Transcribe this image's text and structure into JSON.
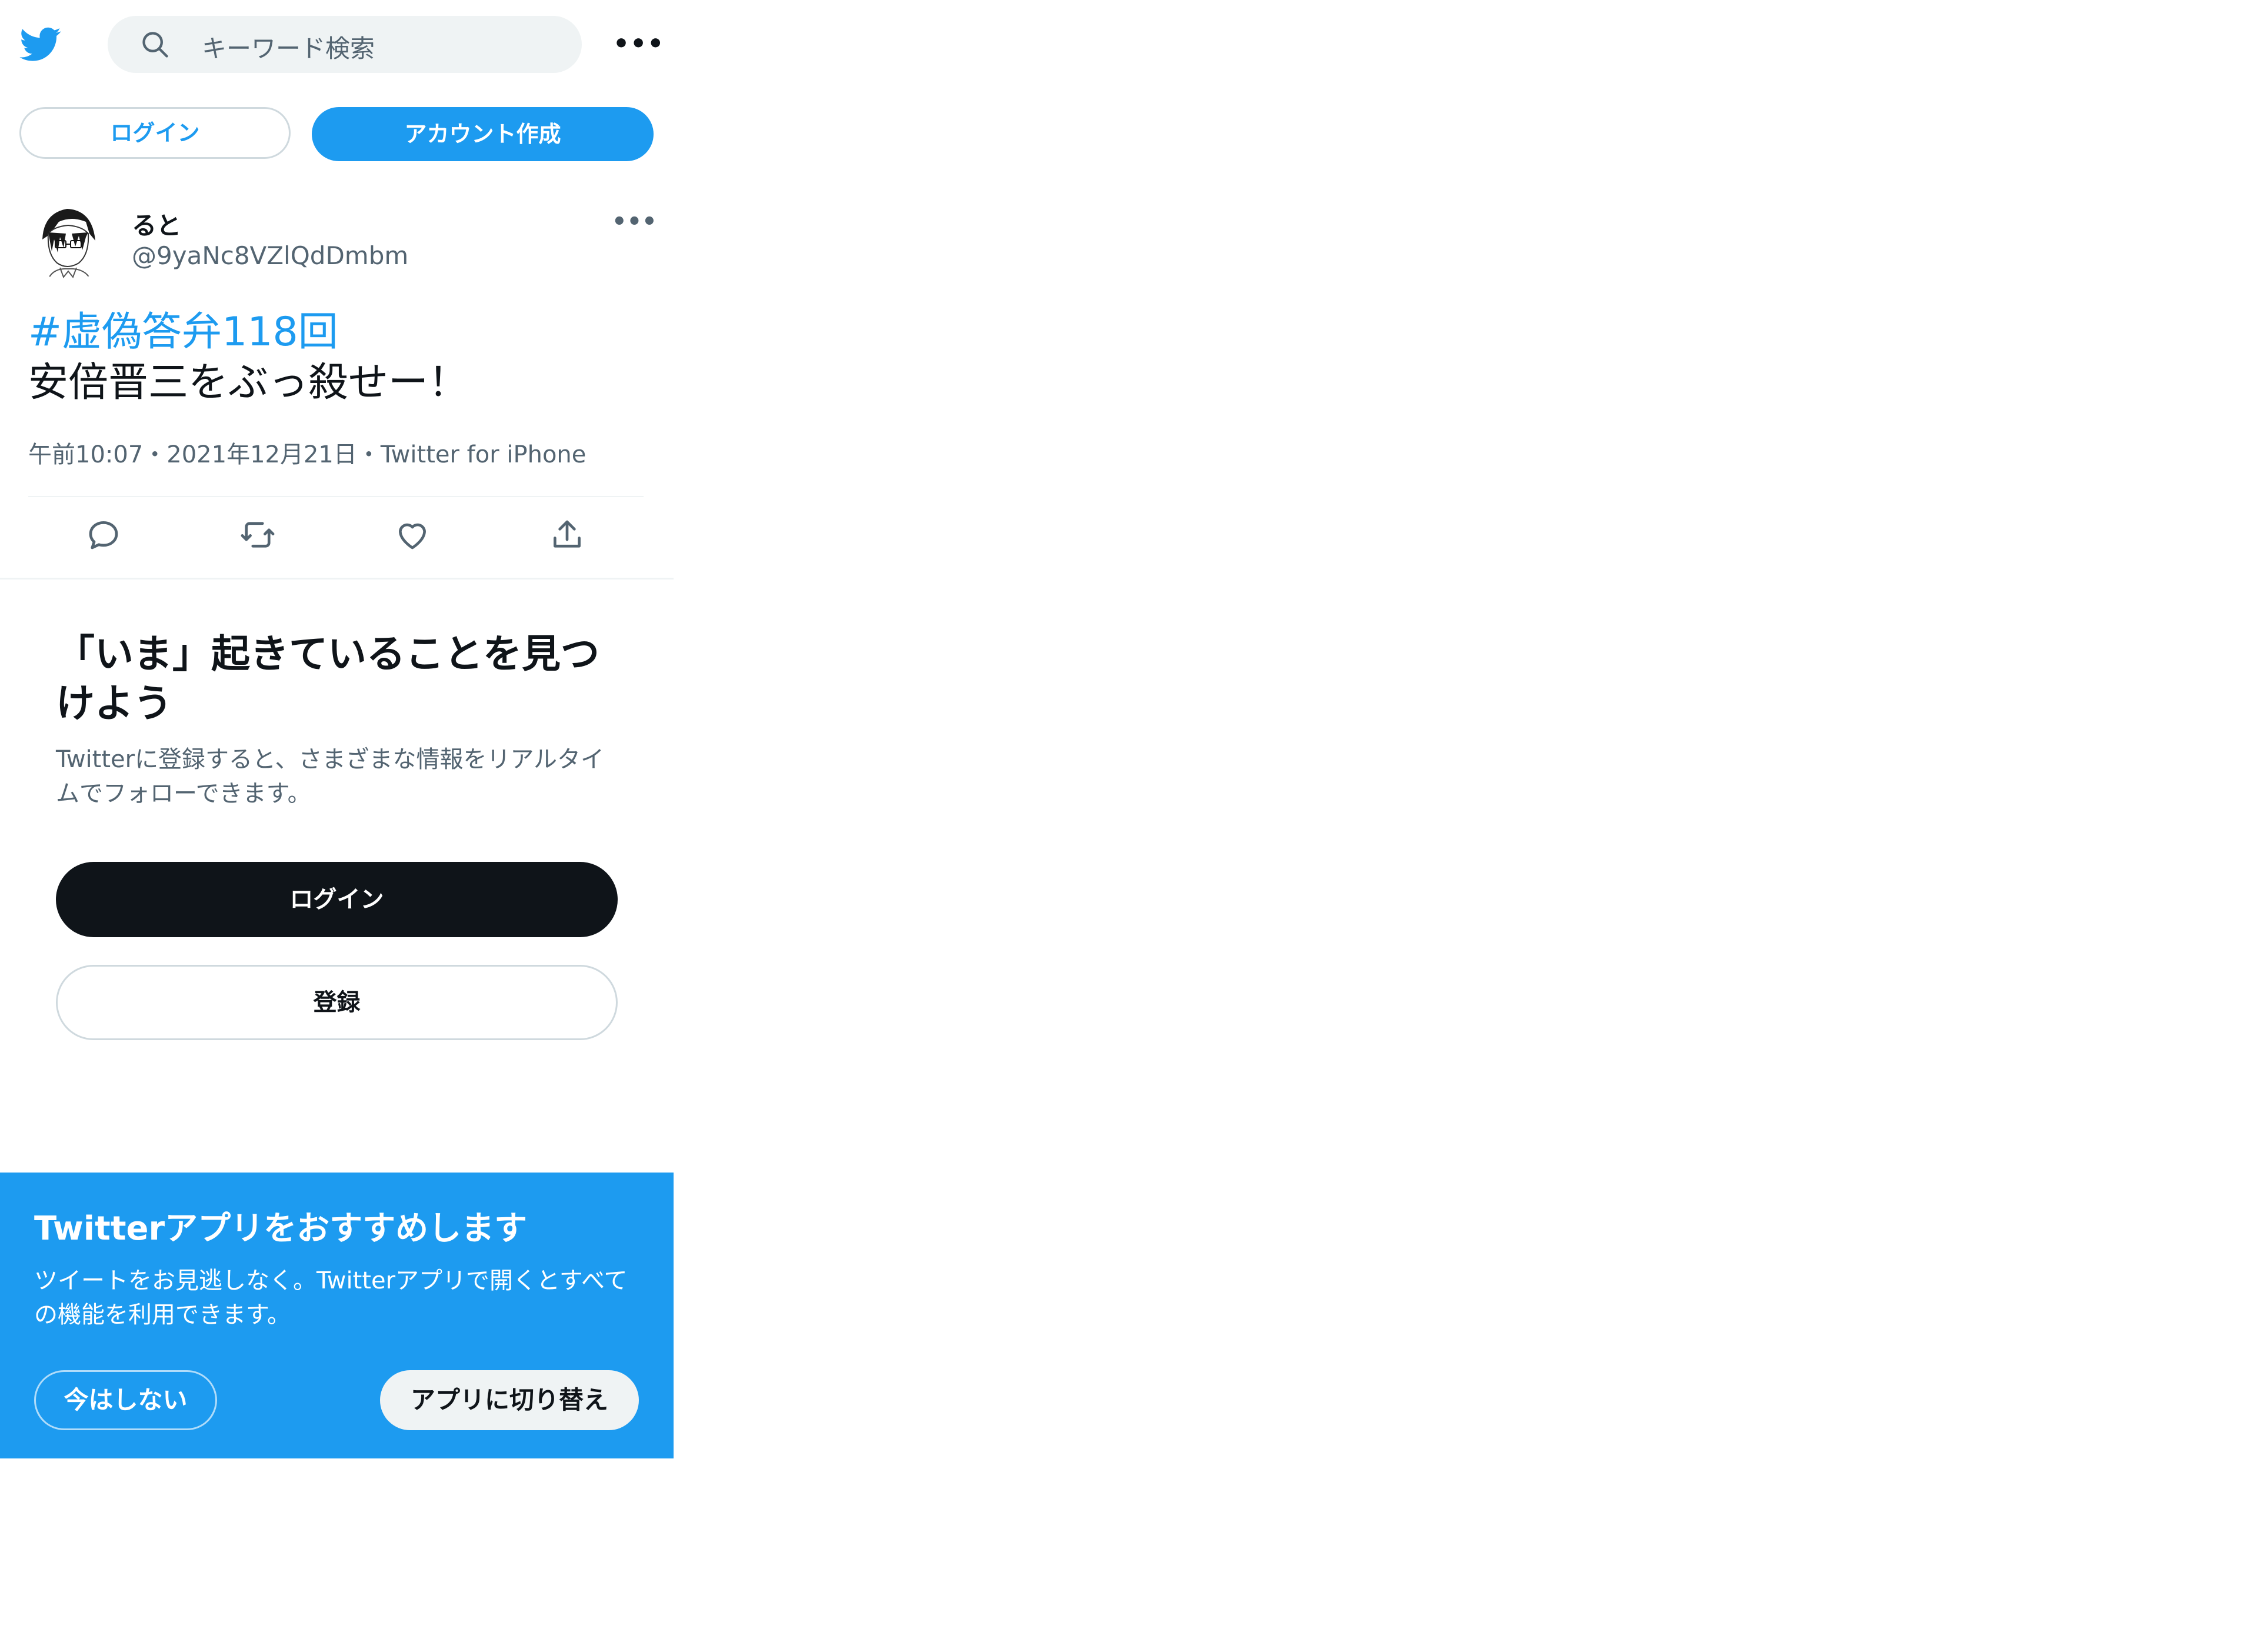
{
  "header": {
    "logo_icon": "twitter-bird-icon",
    "search_placeholder": "キーワード検索",
    "more_label": "•••"
  },
  "top_buttons": {
    "login": "ログイン",
    "signup": "アカウント作成"
  },
  "tweet": {
    "display_name": "ると",
    "handle": "@9yaNc8VZlQdDmbm",
    "more_label": "•••",
    "hashtag": "#虚偽答弁118回",
    "text": "安倍晋三をぶっ殺せー！",
    "meta": "午前10:07・2021年12月21日・Twitter for iPhone",
    "actions": [
      "reply-icon",
      "retweet-icon",
      "like-icon",
      "share-icon"
    ]
  },
  "discover": {
    "title": "「いま」起きていることを見つけよう",
    "subtitle": "Twitterに登録すると、さまざまな情報をリアルタイムでフォローできます。",
    "login_label": "ログイン",
    "register_label": "登録"
  },
  "app_banner": {
    "title": "Twitterアプリをおすすめします",
    "text": "ツイートをお見逃しなく。Twitterアプリで開くとすべての機能を利用できます。",
    "not_now_label": "今はしない",
    "switch_label": "アプリに切り替え"
  },
  "colors": {
    "brand_blue": "#1d9bf0",
    "dark_button": "#0f1419",
    "muted_text": "#536471"
  }
}
